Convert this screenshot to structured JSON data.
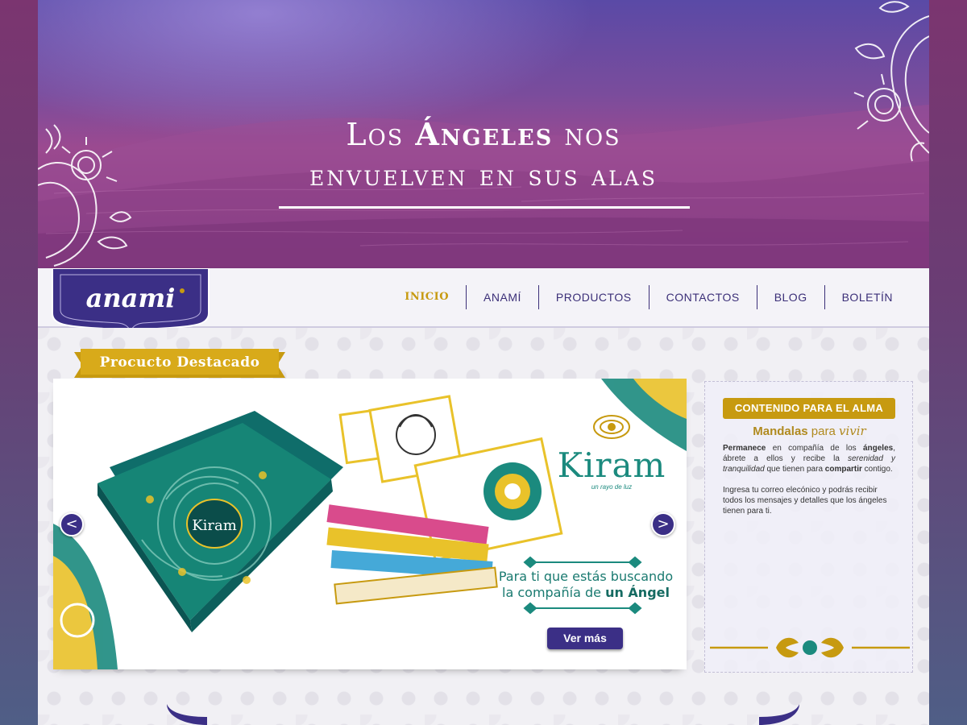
{
  "hero": {
    "line1_pre": "Los",
    "line1_bold": "Ángeles",
    "line1_post": "nos",
    "line2": "envuelven en sus alas"
  },
  "brand": {
    "logo_text": "anami"
  },
  "nav": {
    "items": [
      "INICIO",
      "ANAMÍ",
      "PRODUCTOS",
      "CONTACTOS",
      "BLOG",
      "BOLETÍN"
    ],
    "active": "INICIO"
  },
  "featured": {
    "ribbon_label": "Procucto Destacado",
    "slide": {
      "brand_word": "Kiram",
      "brand_tagline": "un rayo de luz",
      "promo_line1": "Para ti que estás buscando",
      "promo_line2_pre": "la compañía de",
      "promo_line2_bold": "un Ángel",
      "cta": "Ver más",
      "prev": "<",
      "next": ">"
    }
  },
  "sidebar": {
    "ribbon_label": "CONTENIDO PARA EL ALMA",
    "title_bold": "Mandalas",
    "title_para": "para",
    "title_italic": "vivir",
    "p1_b1": "Permanece",
    "p1_t1": " en compañía de los ",
    "p1_b2": "ángeles",
    "p1_t2": ", ábrete a ellos y recibe la ",
    "p1_i1": "serenidad y tranquilidad",
    "p1_t3": " que tienen para ",
    "p1_b3": "compartir",
    "p1_t4": " contigo.",
    "p2": "Ingresa tu correo elecónico y podrás recibir todos los mensajes y detalles que los ángeles tienen para ti."
  },
  "colors": {
    "accent_gold": "#c79a10",
    "brand_purple": "#3b2f86",
    "teal": "#1b8a7e"
  }
}
